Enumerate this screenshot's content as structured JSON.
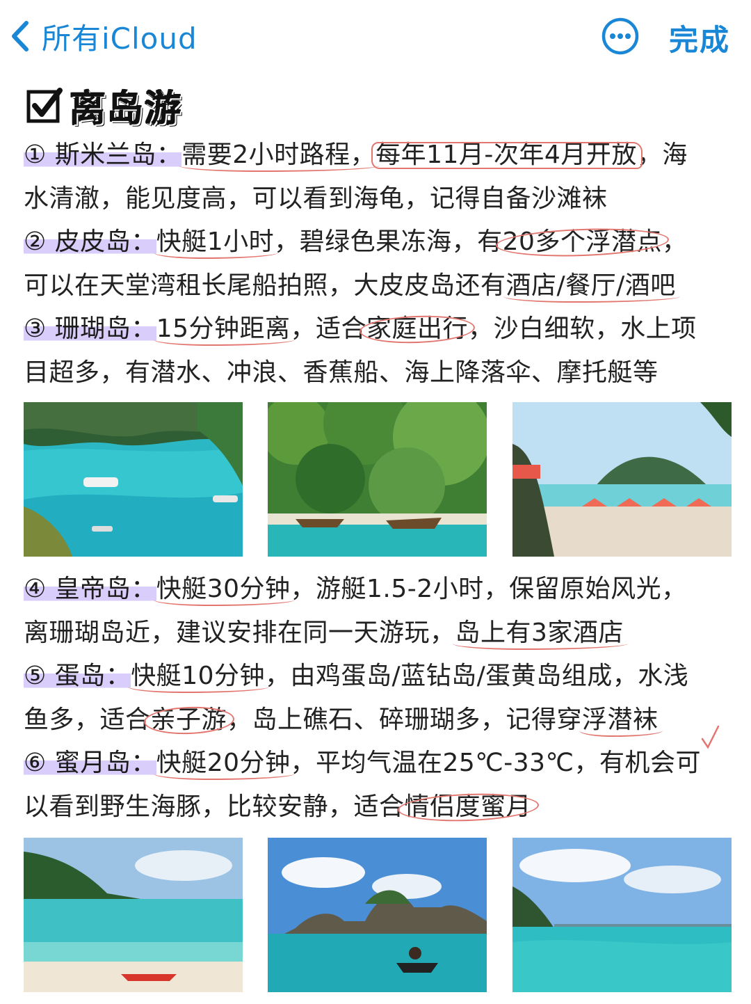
{
  "nav": {
    "back_label": "所有iCloud",
    "done_label": "完成"
  },
  "note": {
    "title": "离岛游",
    "sections": [
      {
        "lines": [
          [
            "① 斯米兰岛：",
            "需要2小时路程，",
            "每年11月-次年4月开放",
            "，海"
          ],
          [
            "水清澈，能见度高，可以看到海龟，记得自备沙滩袜"
          ]
        ]
      },
      {
        "lines": [
          [
            "② 皮皮岛：",
            "快艇1小时",
            "，碧绿色果冻海，有",
            "20多个浮潜点",
            "，"
          ],
          [
            "可以在天堂湾租长尾船拍照，大皮皮岛还有",
            "酒店/餐厅/酒吧"
          ]
        ]
      },
      {
        "lines": [
          [
            "③ 珊瑚岛：",
            "15分钟距离",
            "，适合",
            "家庭出行",
            "，沙白细软，水上项"
          ],
          [
            "目超多，有潜水、冲浪、香蕉船、海上降落伞、摩托艇等"
          ]
        ]
      },
      {
        "lines": [
          [
            "④ 皇帝岛：",
            "快艇30分钟",
            "，游艇1.5-2小时，保留原始风光，"
          ],
          [
            "离珊瑚岛近，建议安排在同一天游玩，",
            "岛上有3家酒店"
          ]
        ]
      },
      {
        "lines": [
          [
            "⑤ 蛋岛：",
            "快艇10分钟",
            "，由鸡蛋岛/蓝钻岛/蛋黄岛组成，水浅"
          ],
          [
            "鱼多，适合",
            "亲子游",
            "，岛上礁石、碎珊瑚多，记得穿",
            "浮潜袜"
          ]
        ]
      },
      {
        "lines": [
          [
            "⑥ 蜜月岛：",
            "快艇20分钟",
            "，平均气温在25℃-33℃，有机会可"
          ],
          [
            "以看到野生海豚，比较安静，适合",
            "情侣度蜜月"
          ]
        ]
      }
    ]
  },
  "icons": {
    "back": "chevron-left-icon",
    "more": "ellipsis-circle-icon",
    "heading": "checkbox-checked-icon"
  },
  "colors": {
    "accent": "#1a87d6",
    "highlight": "#d9cdfb",
    "annotation": "#e2766f"
  }
}
